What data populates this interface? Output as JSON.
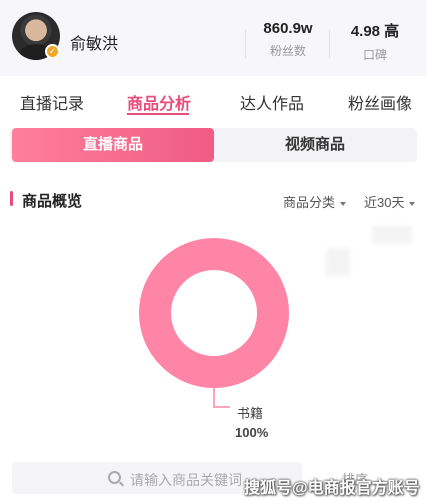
{
  "profile": {
    "name": "俞敏洪",
    "fans_value": "860.9w",
    "fans_label": "粉丝数",
    "rating_value": "4.98 高",
    "rating_label": "口碑"
  },
  "tabs": [
    {
      "label": "直播记录",
      "active": false
    },
    {
      "label": "商品分析",
      "active": true
    },
    {
      "label": "达人作品",
      "active": false
    },
    {
      "label": "粉丝画像",
      "active": false
    }
  ],
  "segments": [
    {
      "label": "直播商品",
      "active": true
    },
    {
      "label": "视频商品",
      "active": false
    }
  ],
  "section": {
    "title": "商品概览",
    "category_filter": "商品分类",
    "period_filter": "近30天"
  },
  "chart_data": {
    "type": "pie",
    "slices": [
      {
        "label": "书籍",
        "value": 100,
        "display": "100%"
      }
    ],
    "colors": [
      "#ff85a6"
    ]
  },
  "search": {
    "placeholder": "请输入商品关键词"
  },
  "sort_label": "排序",
  "watermark": "搜狐号@电商报官方账号",
  "colors": {
    "accent": "#e84c7b",
    "donut": "#ff85a6"
  }
}
